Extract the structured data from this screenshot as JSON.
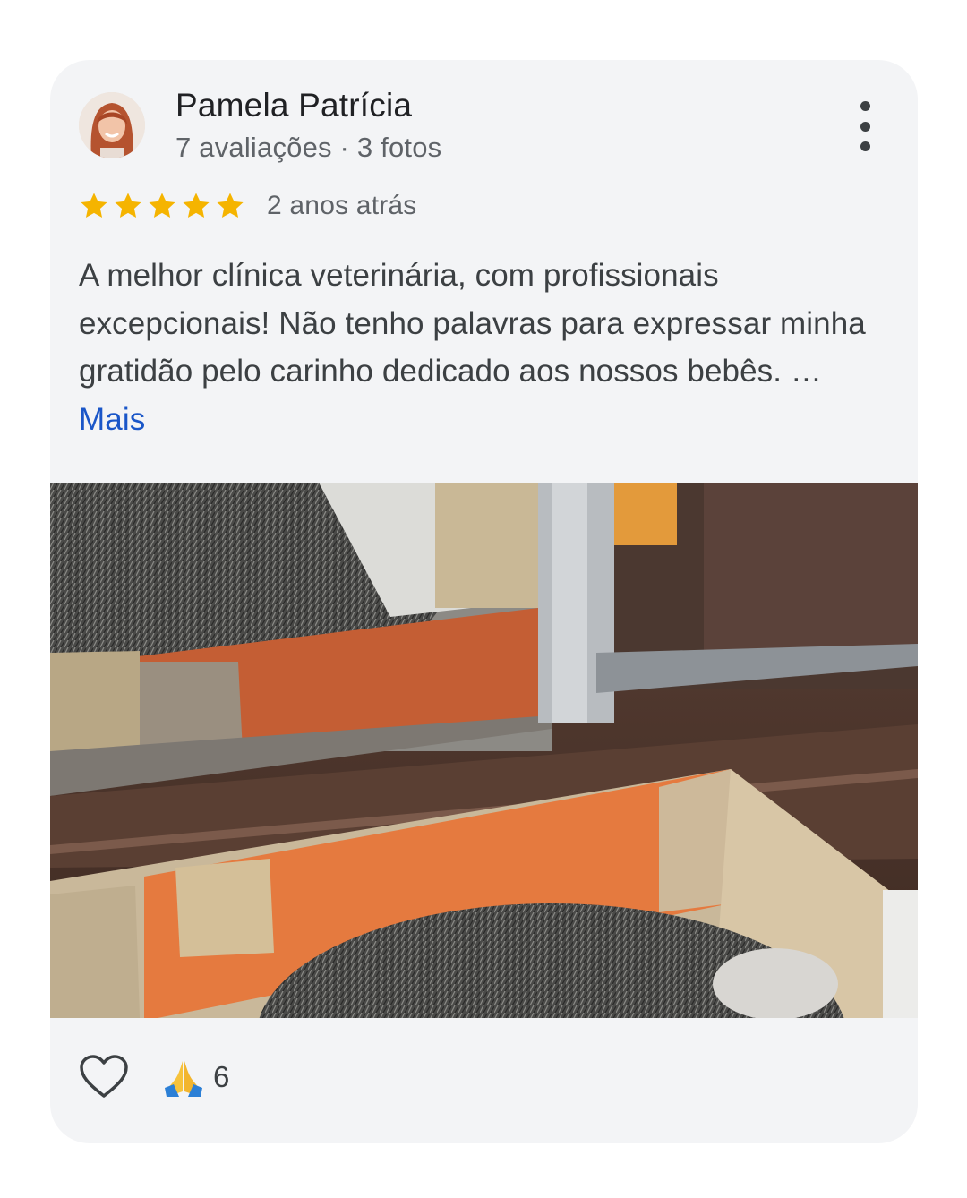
{
  "review": {
    "author": "Pamela Patrícia",
    "author_meta": "7 avaliações · 3 fotos",
    "rating": 5,
    "max_rating": 5,
    "time": "2 anos atrás",
    "text": "A melhor clínica veterinária, com profissionais excepcionais! Não tenho palavras para expressar minha gratidão pelo carinho dedicado aos nossos bebês. … ",
    "more_label": "Mais",
    "reactions": {
      "emoji_name": "folded-hands-emoji",
      "count": "6"
    },
    "icons": {
      "menu": "more-vert-icon",
      "like": "heart-outline-icon",
      "star": "star-icon"
    },
    "colors": {
      "star": "#F5B400",
      "link": "#1A56C8",
      "card_bg": "#F3F4F6"
    }
  }
}
